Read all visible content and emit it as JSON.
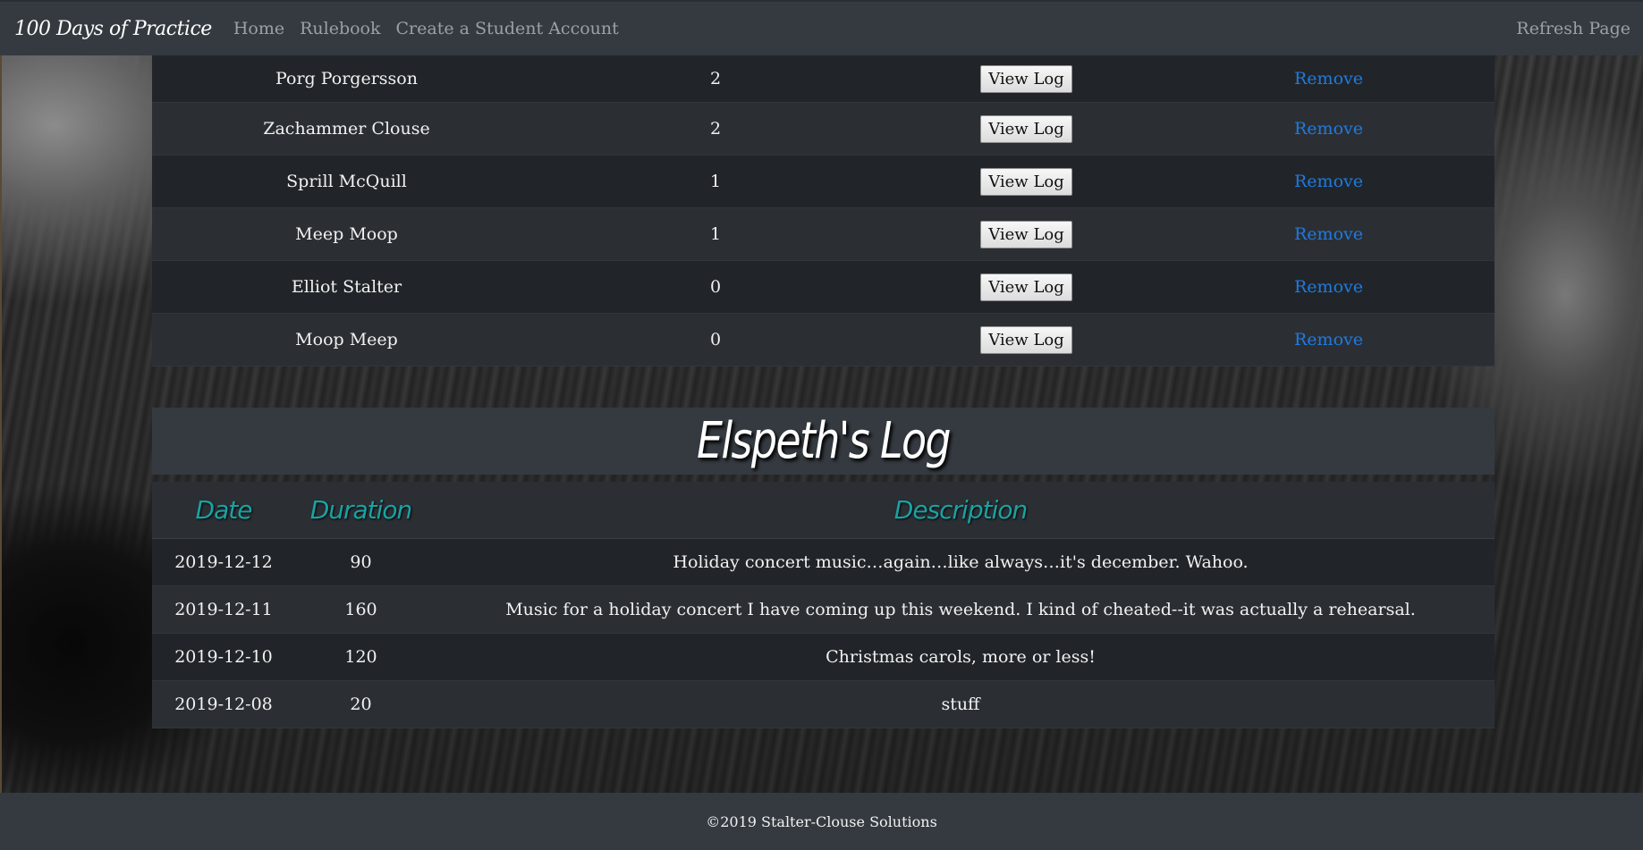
{
  "navbar": {
    "brand": "100 Days of Practice",
    "links": [
      "Home",
      "Rulebook",
      "Create a Student Account"
    ],
    "refresh": "Refresh Page"
  },
  "students": {
    "view_label": "View Log",
    "remove_label": "Remove",
    "rows": [
      {
        "name": "Porg Porgersson",
        "days": "2"
      },
      {
        "name": "Zachammer Clouse",
        "days": "2"
      },
      {
        "name": "Sprill McQuill",
        "days": "1"
      },
      {
        "name": "Meep Moop",
        "days": "1"
      },
      {
        "name": "Elliot Stalter",
        "days": "0"
      },
      {
        "name": "Moop Meep",
        "days": "0"
      }
    ]
  },
  "log": {
    "title": "Elspeth's Log",
    "headers": {
      "date": "Date",
      "duration": "Duration",
      "description": "Description"
    },
    "rows": [
      {
        "date": "2019-12-12",
        "duration": "90",
        "description": "Holiday concert music…again…like always…it's december. Wahoo."
      },
      {
        "date": "2019-12-11",
        "duration": "160",
        "description": "Music for a holiday concert I have coming up this weekend. I kind of cheated--it was actually a rehearsal."
      },
      {
        "date": "2019-12-10",
        "duration": "120",
        "description": "Christmas carols, more or less!"
      },
      {
        "date": "2019-12-08",
        "duration": "20",
        "description": "stuff"
      }
    ]
  },
  "footer": {
    "text": "©2019 Stalter-Clouse Solutions"
  },
  "colors": {
    "navbar": "#343a40",
    "link": "#1f7ae0",
    "header_teal": "#1aa2a2"
  }
}
